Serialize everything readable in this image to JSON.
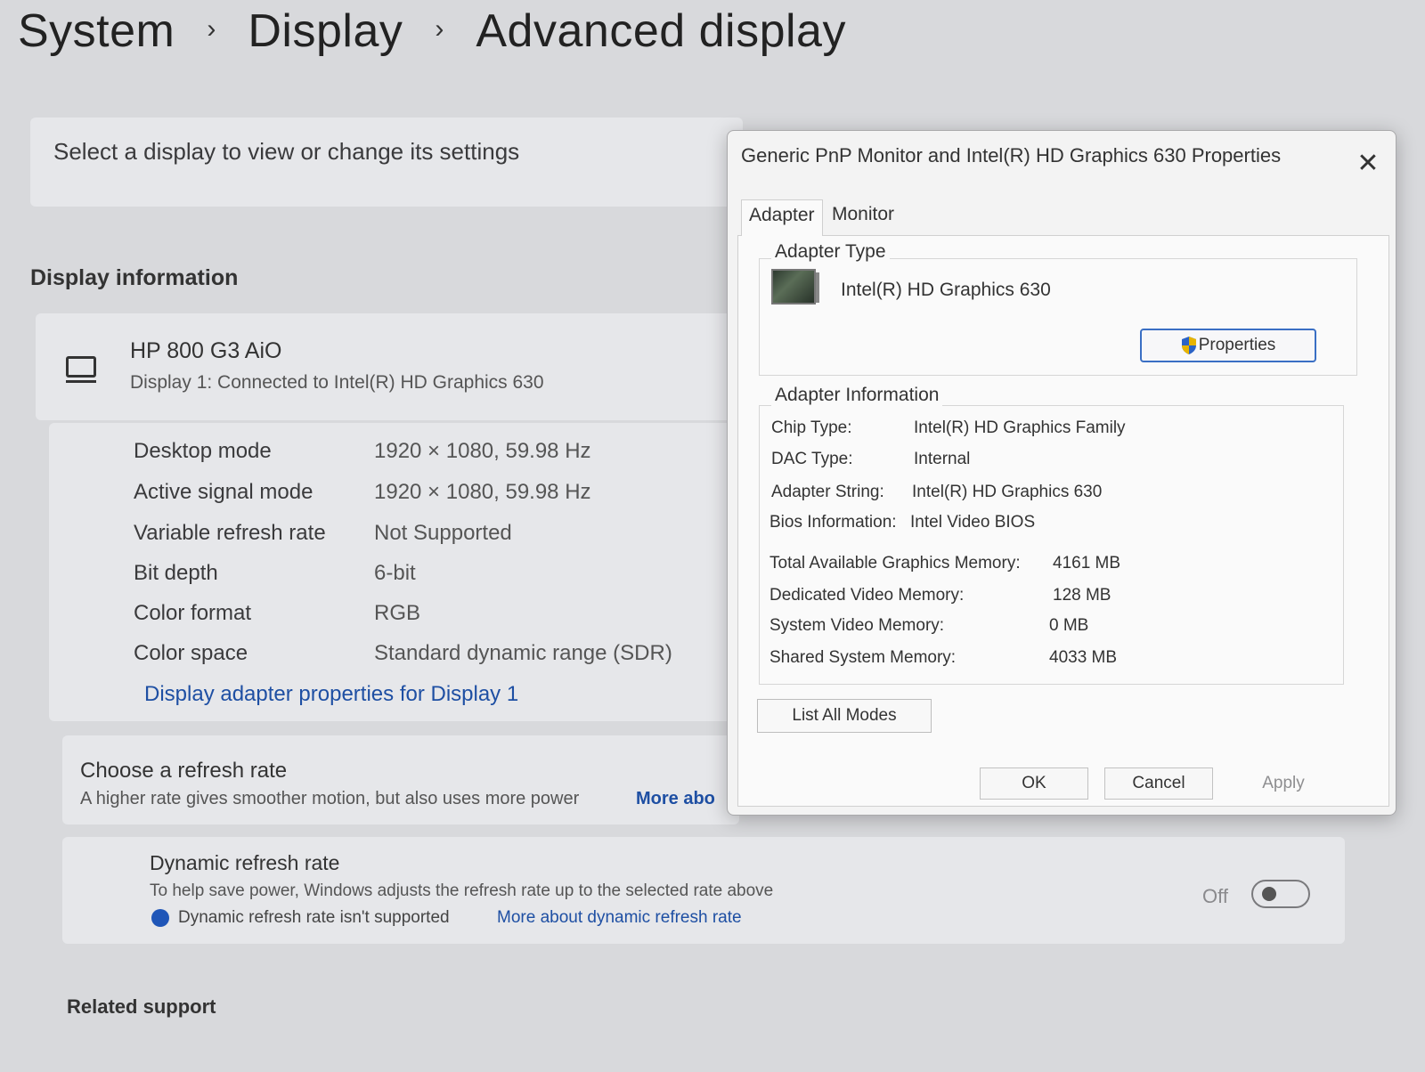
{
  "breadcrumb": {
    "items": [
      "System",
      "Display",
      "Advanced display"
    ],
    "separator": "›"
  },
  "select_display": {
    "text": "Select a display to view or change its settings"
  },
  "display_information": {
    "title": "Display information",
    "display_name": "HP 800 G3 AiO",
    "display_connection": "Display 1: Connected to Intel(R) HD Graphics 630",
    "rows": [
      {
        "label": "Desktop mode",
        "value": "1920 × 1080, 59.98 Hz"
      },
      {
        "label": "Active signal mode",
        "value": "1920 × 1080, 59.98 Hz"
      },
      {
        "label": "Variable refresh rate",
        "value": "Not Supported"
      },
      {
        "label": "Bit depth",
        "value": "6-bit"
      },
      {
        "label": "Color format",
        "value": "RGB"
      },
      {
        "label": "Color space",
        "value": "Standard dynamic range (SDR)"
      }
    ],
    "adapter_link": "Display adapter properties for Display 1"
  },
  "refresh_rate": {
    "title": "Choose a refresh rate",
    "description": "A higher rate gives smoother motion, but also uses more power",
    "more_link": "More abo"
  },
  "dynamic_refresh": {
    "title": "Dynamic refresh rate",
    "description": "To help save power, Windows adjusts the refresh rate up to the selected rate above",
    "note": "Dynamic refresh rate isn't supported",
    "link": "More about dynamic refresh rate",
    "toggle_state": "Off",
    "toggle_on": false
  },
  "related_support": {
    "title": "Related support"
  },
  "dialog": {
    "title": "Generic PnP Monitor and Intel(R) HD Graphics 630 Properties",
    "close_glyph": "✕",
    "tabs": [
      "Adapter",
      "Monitor"
    ],
    "active_tab": "Adapter",
    "adapter_type": {
      "label": "Adapter Type",
      "value": "Intel(R) HD Graphics 630",
      "properties_button": "Properties"
    },
    "adapter_information": {
      "label": "Adapter Information",
      "rows": [
        {
          "label": "Chip Type:",
          "value": "Intel(R) HD Graphics Family"
        },
        {
          "label": "DAC Type:",
          "value": "Internal"
        },
        {
          "label": "Adapter String:",
          "value": "Intel(R) HD Graphics 630"
        },
        {
          "label": "Bios Information:",
          "value": "Intel Video BIOS"
        }
      ],
      "memory_rows": [
        {
          "label": "Total Available Graphics Memory:",
          "value": "4161 MB"
        },
        {
          "label": "Dedicated Video Memory:",
          "value": "128 MB"
        },
        {
          "label": "System Video Memory:",
          "value": "0 MB"
        },
        {
          "label": "Shared System Memory:",
          "value": "4033 MB"
        }
      ]
    },
    "list_all_modes_button": "List All Modes",
    "ok_button": "OK",
    "cancel_button": "Cancel",
    "apply_button": "Apply"
  },
  "colors": {
    "background": "#d8d9dc",
    "card": "#e6e7ea",
    "link": "#1e4fa3",
    "dialog_bg": "#f3f3f3",
    "accent_border": "#3a6fc4"
  },
  "icons": {
    "monitor": "monitor-icon",
    "gpu": "gpu-card-icon",
    "shield": "uac-shield-icon",
    "info": "info-icon",
    "close": "close-icon"
  }
}
